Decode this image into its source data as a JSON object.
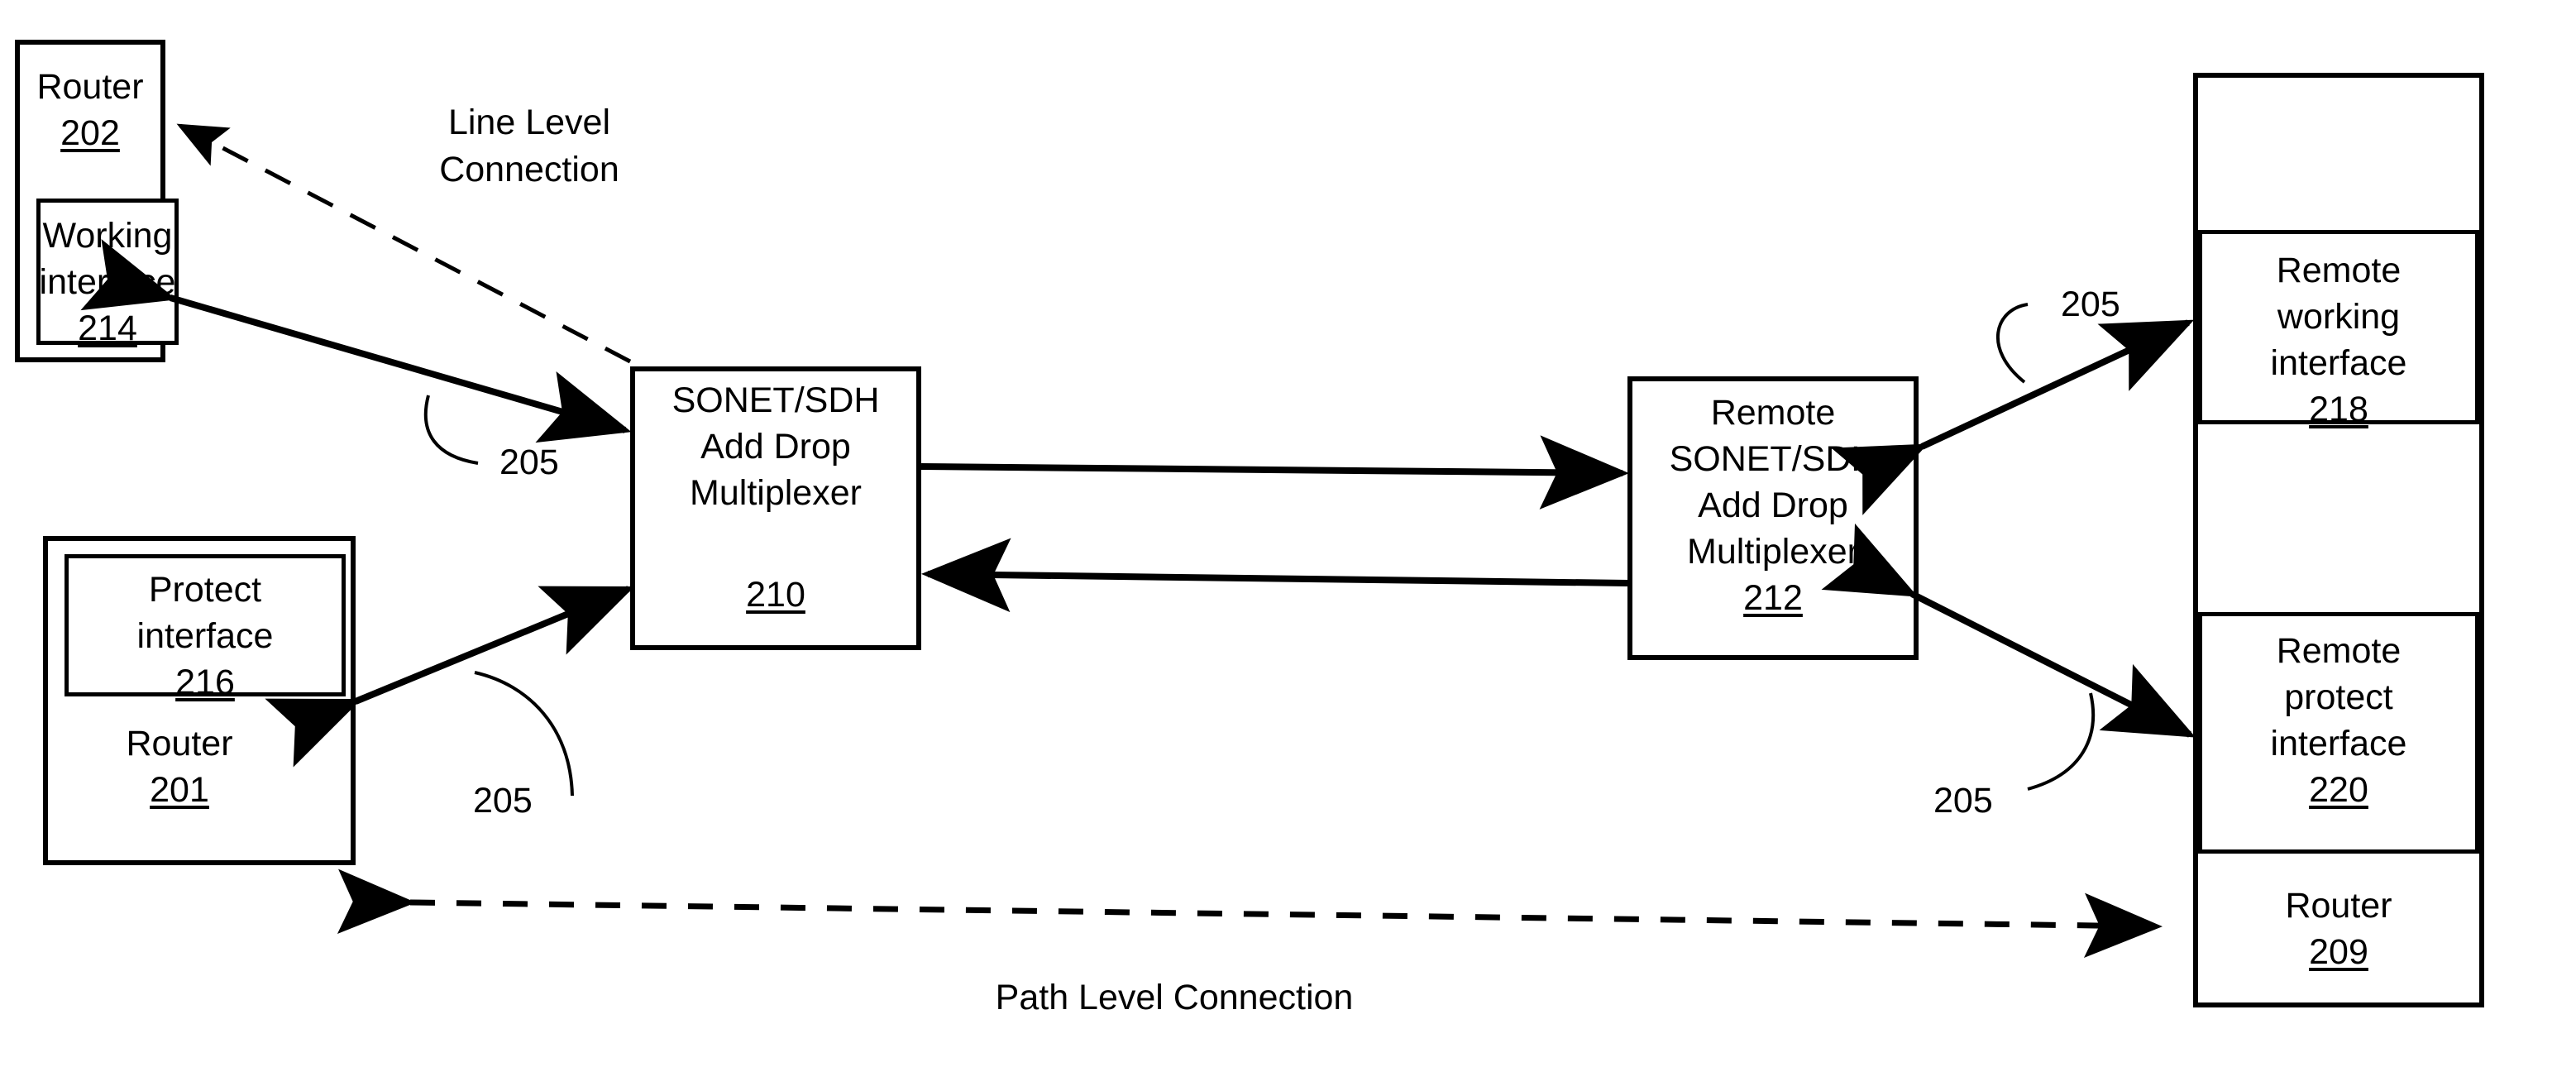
{
  "figure": {
    "type": "network-protection-diagram",
    "nodes": {
      "router202": {
        "title": "Router",
        "ref": "202"
      },
      "working_interface": {
        "title_line1": "Working",
        "title_line2": "interface",
        "ref": "214"
      },
      "router201": {
        "title": "Router",
        "ref": "201"
      },
      "protect_interface": {
        "title_line1": "Protect",
        "title_line2": "interface",
        "ref": "216"
      },
      "adm210": {
        "title_line1": "SONET/SDH",
        "title_line2": "Add Drop",
        "title_line3": "Multiplexer",
        "ref": "210"
      },
      "adm212": {
        "title_line1": "Remote",
        "title_line2": "SONET/SDH",
        "title_line3": "Add Drop",
        "title_line4": "Multiplexer",
        "ref": "212"
      },
      "router209": {
        "title": "Router",
        "ref": "209"
      },
      "remote_working_interface": {
        "title_line1": "Remote",
        "title_line2": "working",
        "title_line3": "interface",
        "ref": "218"
      },
      "remote_protect_interface": {
        "title_line1": "Remote",
        "title_line2": "protect",
        "title_line3": "interface",
        "ref": "220"
      }
    },
    "connections": {
      "line_level": {
        "label_line1": "Line Level",
        "label_line2": "Connection"
      },
      "path_level": {
        "label": "Path Level Connection"
      }
    },
    "callouts": {
      "working_to_adm": "205",
      "protect_to_adm": "205",
      "adm_to_remote_working": "205",
      "adm_to_remote_protect": "205"
    }
  }
}
